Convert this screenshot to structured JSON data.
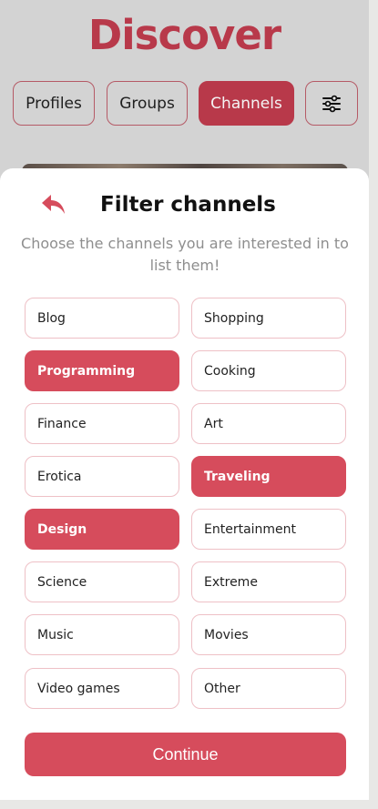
{
  "header": {
    "title": "Discover"
  },
  "tabs": [
    {
      "label": "Profiles",
      "active": false
    },
    {
      "label": "Groups",
      "active": false
    },
    {
      "label": "Channels",
      "active": true
    }
  ],
  "filter_button": {
    "icon": "sliders-icon"
  },
  "sheet": {
    "back_icon": "reply-arrow-icon",
    "title": "Filter channels",
    "subtitle": "Choose the channels you are interested in to list them!",
    "options": [
      {
        "label": "Blog",
        "selected": false
      },
      {
        "label": "Shopping",
        "selected": false
      },
      {
        "label": "Programming",
        "selected": true
      },
      {
        "label": "Cooking",
        "selected": false
      },
      {
        "label": "Finance",
        "selected": false
      },
      {
        "label": "Art",
        "selected": false
      },
      {
        "label": "Erotica",
        "selected": false
      },
      {
        "label": "Traveling",
        "selected": true
      },
      {
        "label": "Design",
        "selected": true
      },
      {
        "label": "Entertainment",
        "selected": false
      },
      {
        "label": "Science",
        "selected": false
      },
      {
        "label": "Extreme",
        "selected": false
      },
      {
        "label": "Music",
        "selected": false
      },
      {
        "label": "Movies",
        "selected": false
      },
      {
        "label": "Video games",
        "selected": false
      },
      {
        "label": "Other",
        "selected": false
      }
    ],
    "continue_label": "Continue"
  },
  "colors": {
    "brand": "#b8394a",
    "accent": "#d64c5c",
    "option_border": "#eec0c6",
    "subtitle_text": "#8e8e8e"
  }
}
